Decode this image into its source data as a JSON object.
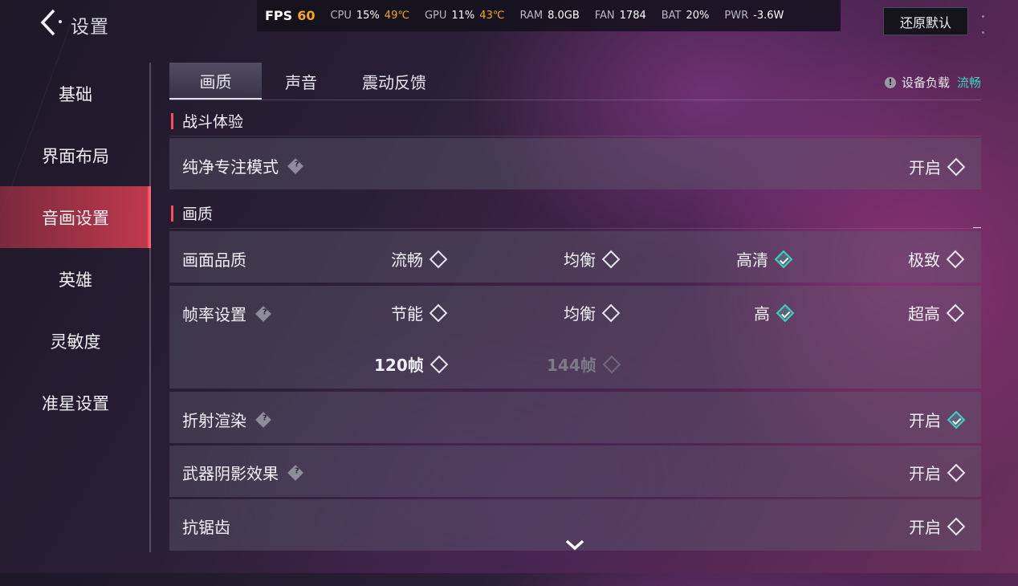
{
  "header": {
    "title": "设置",
    "reset_label": "还原默认"
  },
  "status": {
    "fps_label": "FPS",
    "fps_value": "60",
    "cpu_label": "CPU",
    "cpu_value": "15%",
    "cpu_temp": "49℃",
    "gpu_label": "GPU",
    "gpu_value": "11%",
    "gpu_temp": "43℃",
    "ram_label": "RAM",
    "ram_value": "8.0GB",
    "fan_label": "FAN",
    "fan_value": "1784",
    "bat_label": "BAT",
    "bat_value": "20%",
    "pwr_label": "PWR",
    "pwr_value": "-3.6W"
  },
  "sidebar": {
    "items": [
      {
        "label": "基础"
      },
      {
        "label": "界面布局"
      },
      {
        "label": "音画设置"
      },
      {
        "label": "英雄"
      },
      {
        "label": "灵敏度"
      },
      {
        "label": "准星设置"
      }
    ],
    "active_index": 2
  },
  "tabs": {
    "items": [
      {
        "label": "画质"
      },
      {
        "label": "声音"
      },
      {
        "label": "震动反馈"
      }
    ],
    "active_index": 0
  },
  "device_load": {
    "label": "设备负载",
    "status": "流畅",
    "status_color": "#3fd0c0"
  },
  "sections": {
    "battle": "战斗体验",
    "quality": "画质"
  },
  "rows": {
    "pure_focus": {
      "label": "纯净专注模式",
      "option": "开启",
      "selected": false
    },
    "picture_quality": {
      "label": "画面品质",
      "options": [
        {
          "label": "流畅",
          "selected": false
        },
        {
          "label": "均衡",
          "selected": false
        },
        {
          "label": "高清",
          "selected": true
        },
        {
          "label": "极致",
          "selected": false
        }
      ]
    },
    "frame_rate": {
      "label": "帧率设置",
      "options": [
        {
          "label": "节能",
          "selected": false
        },
        {
          "label": "均衡",
          "selected": false
        },
        {
          "label": "高",
          "selected": true
        },
        {
          "label": "超高",
          "selected": false
        },
        {
          "label": "120帧",
          "selected": false
        },
        {
          "label": "144帧",
          "selected": false,
          "disabled": true
        }
      ]
    },
    "refraction": {
      "label": "折射渲染",
      "option": "开启",
      "selected": true
    },
    "weapon_shadow": {
      "label": "武器阴影效果",
      "option": "开启",
      "selected": false
    },
    "antialias": {
      "label": "抗锯齿",
      "option": "开启",
      "selected": false
    }
  },
  "icons": {
    "help": "?",
    "warning": "!"
  },
  "colors": {
    "accent_red": "#ff4a5e",
    "selected_teal": "#3fd0c0",
    "fps_orange": "#f5a623"
  }
}
